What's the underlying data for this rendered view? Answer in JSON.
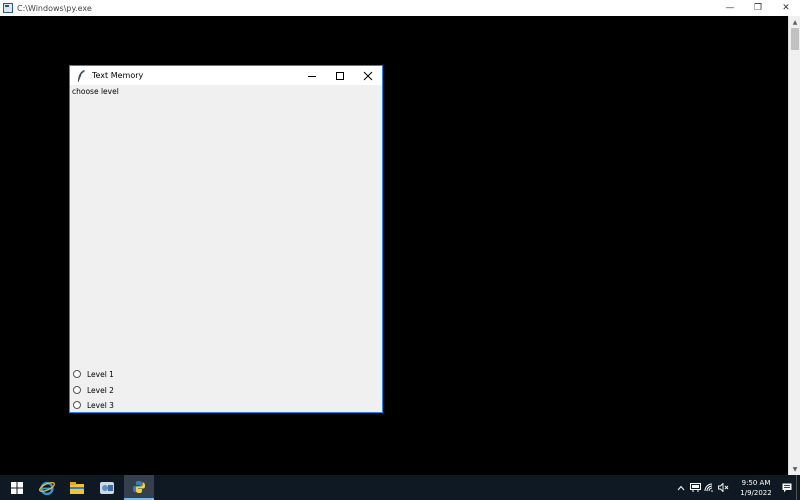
{
  "console": {
    "title": "C:\\Windows\\py.exe",
    "controls": {
      "minimize": "—",
      "restore": "❐",
      "close": "✕"
    }
  },
  "tk_window": {
    "title": "Text Memory",
    "controls": {
      "minimize": "minimize-icon",
      "maximize": "maximize-icon",
      "close": "close-icon"
    },
    "prompt_label": "choose level",
    "levels": [
      {
        "label": "Level 1",
        "selected": false
      },
      {
        "label": "Level 2",
        "selected": false
      },
      {
        "label": "Level 3",
        "selected": false
      }
    ]
  },
  "taskbar": {
    "buttons": [
      "windows-start-icon",
      "internet-explorer-icon",
      "file-explorer-icon",
      "app-icon",
      "python-icon"
    ],
    "tray_icons": [
      "chevron-up-icon",
      "network-adapter-icon",
      "wifi-icon",
      "speaker-muted-icon",
      "notification-icon"
    ],
    "clock": {
      "time": "9:50 AM",
      "date": "1/9/2022"
    }
  },
  "colors": {
    "console_bg": "#000000",
    "tk_border": "#1e88e5",
    "tk_bg": "#f0f0f0",
    "taskbar_bg": "#0f1923",
    "taskbar_active": "#34404d",
    "taskbar_active_indicator": "#76b9ed"
  }
}
